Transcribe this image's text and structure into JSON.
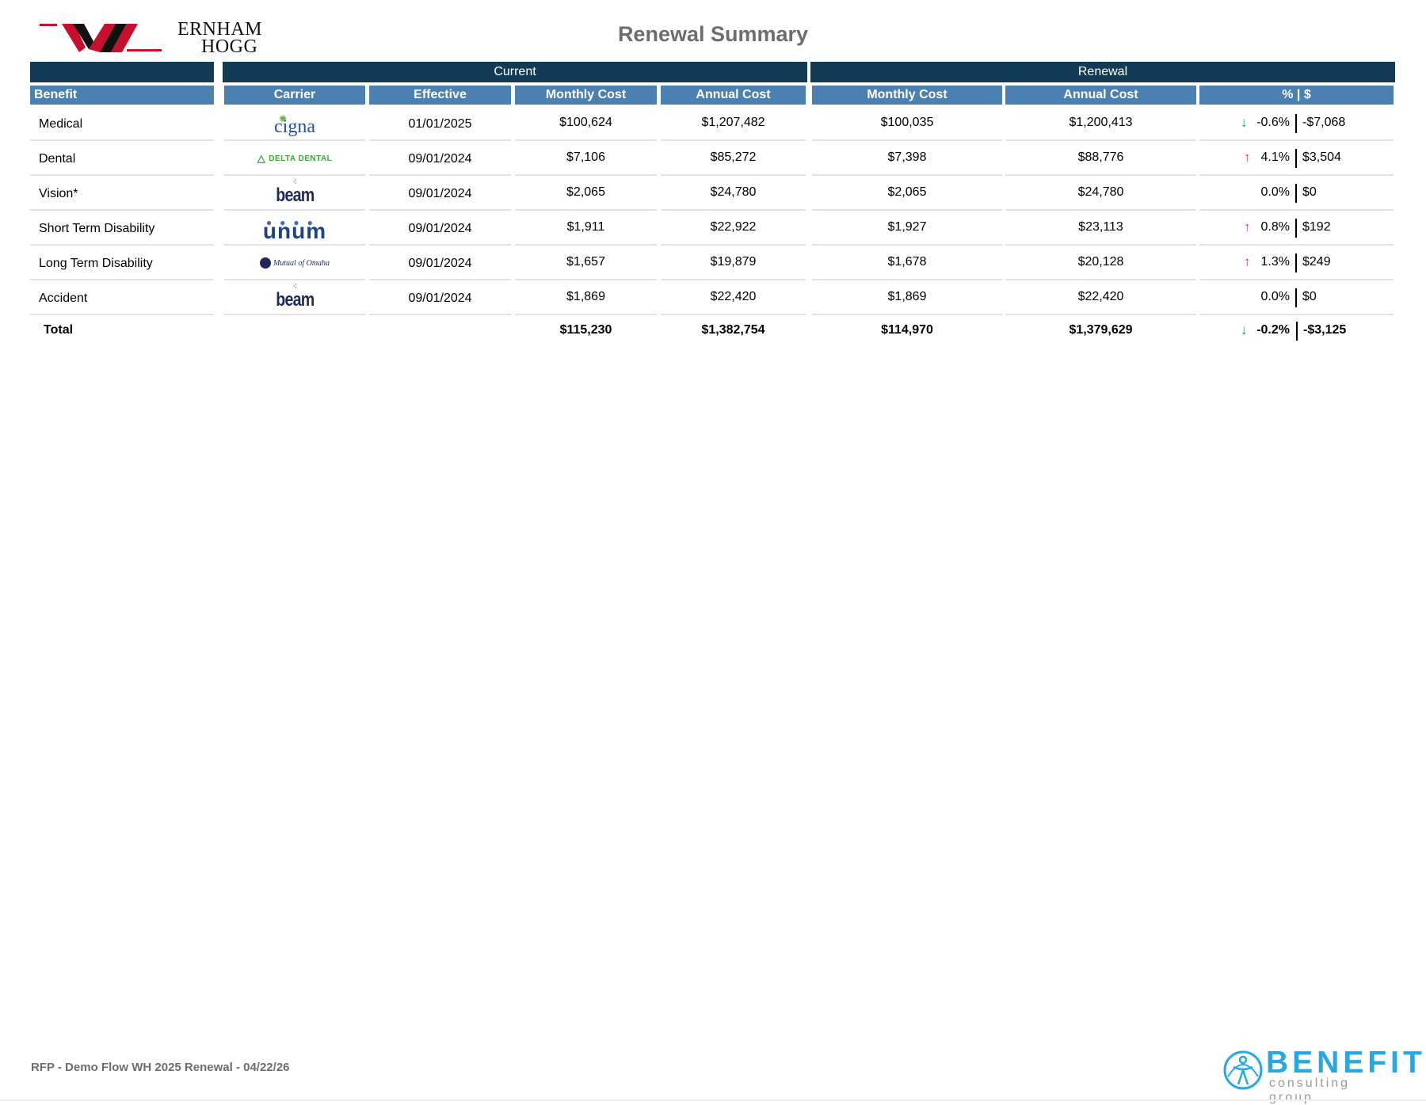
{
  "brand": {
    "line1": "ERNHAM",
    "line2": "HOGG"
  },
  "page_title": "Renewal Summary",
  "bands": {
    "current": "Current",
    "renewal": "Renewal"
  },
  "headers": {
    "benefit": "Benefit",
    "carrier": "Carrier",
    "effective": "Effective",
    "cur_monthly": "Monthly Cost",
    "cur_annual": "Annual Cost",
    "ren_monthly": "Monthly Cost",
    "ren_annual": "Annual Cost",
    "change": "% | $"
  },
  "rows": [
    {
      "benefit": "Medical",
      "carrier_logo": "cigna-logo",
      "carrier_text": "cigna",
      "effective": "01/01/2025",
      "cur_monthly": "$100,624",
      "cur_annual": "$1,207,482",
      "ren_monthly": "$100,035",
      "ren_annual": "$1,200,413",
      "pct": "-0.6%",
      "amt": "-$7,068",
      "trend": "down"
    },
    {
      "benefit": "Dental",
      "carrier_logo": "delta-dental-logo",
      "carrier_text": "DELTA DENTAL",
      "effective": "09/01/2024",
      "cur_monthly": "$7,106",
      "cur_annual": "$85,272",
      "ren_monthly": "$7,398",
      "ren_annual": "$88,776",
      "pct": "4.1%",
      "amt": "$3,504",
      "trend": "up"
    },
    {
      "benefit": "Vision*",
      "carrier_logo": "beam-logo",
      "carrier_text": "beam",
      "effective": "09/01/2024",
      "cur_monthly": "$2,065",
      "cur_annual": "$24,780",
      "ren_monthly": "$2,065",
      "ren_annual": "$24,780",
      "pct": "0.0%",
      "amt": "$0",
      "trend": "none"
    },
    {
      "benefit": "Short Term Disability",
      "carrier_logo": "unum-logo",
      "carrier_text": "unum",
      "effective": "09/01/2024",
      "cur_monthly": "$1,911",
      "cur_annual": "$22,922",
      "ren_monthly": "$1,927",
      "ren_annual": "$23,113",
      "pct": "0.8%",
      "amt": "$192",
      "trend": "up"
    },
    {
      "benefit": "Long Term Disability",
      "carrier_logo": "mutual-of-omaha-logo",
      "carrier_text": "Mutual of Omaha",
      "effective": "09/01/2024",
      "cur_monthly": "$1,657",
      "cur_annual": "$19,879",
      "ren_monthly": "$1,678",
      "ren_annual": "$20,128",
      "pct": "1.3%",
      "amt": "$249",
      "trend": "up"
    },
    {
      "benefit": "Accident",
      "carrier_logo": "beam-logo",
      "carrier_text": "beam",
      "effective": "09/01/2024",
      "cur_monthly": "$1,869",
      "cur_annual": "$22,420",
      "ren_monthly": "$1,869",
      "ren_annual": "$22,420",
      "pct": "0.0%",
      "amt": "$0",
      "trend": "none"
    }
  ],
  "total": {
    "label": "Total",
    "cur_monthly": "$115,230",
    "cur_annual": "$1,382,754",
    "ren_monthly": "$114,970",
    "ren_annual": "$1,379,629",
    "pct": "-0.2%",
    "amt": "-$3,125",
    "trend": "down"
  },
  "footer": {
    "text": "RFP - Demo Flow WH 2025 Renewal - 04/22/26",
    "bcg_word": "BENEFIT",
    "bcg_sub": "consulting group"
  },
  "colors": {
    "band": "#123b55",
    "header": "#4c80b1",
    "up": "#e0344c",
    "down": "#1a9a7a",
    "title": "#6d6d6d",
    "bcg_blue": "#29a8e0",
    "brand_red": "#c8102e"
  },
  "icons": {
    "up": "arrow-up-icon",
    "down": "arrow-down-icon"
  }
}
